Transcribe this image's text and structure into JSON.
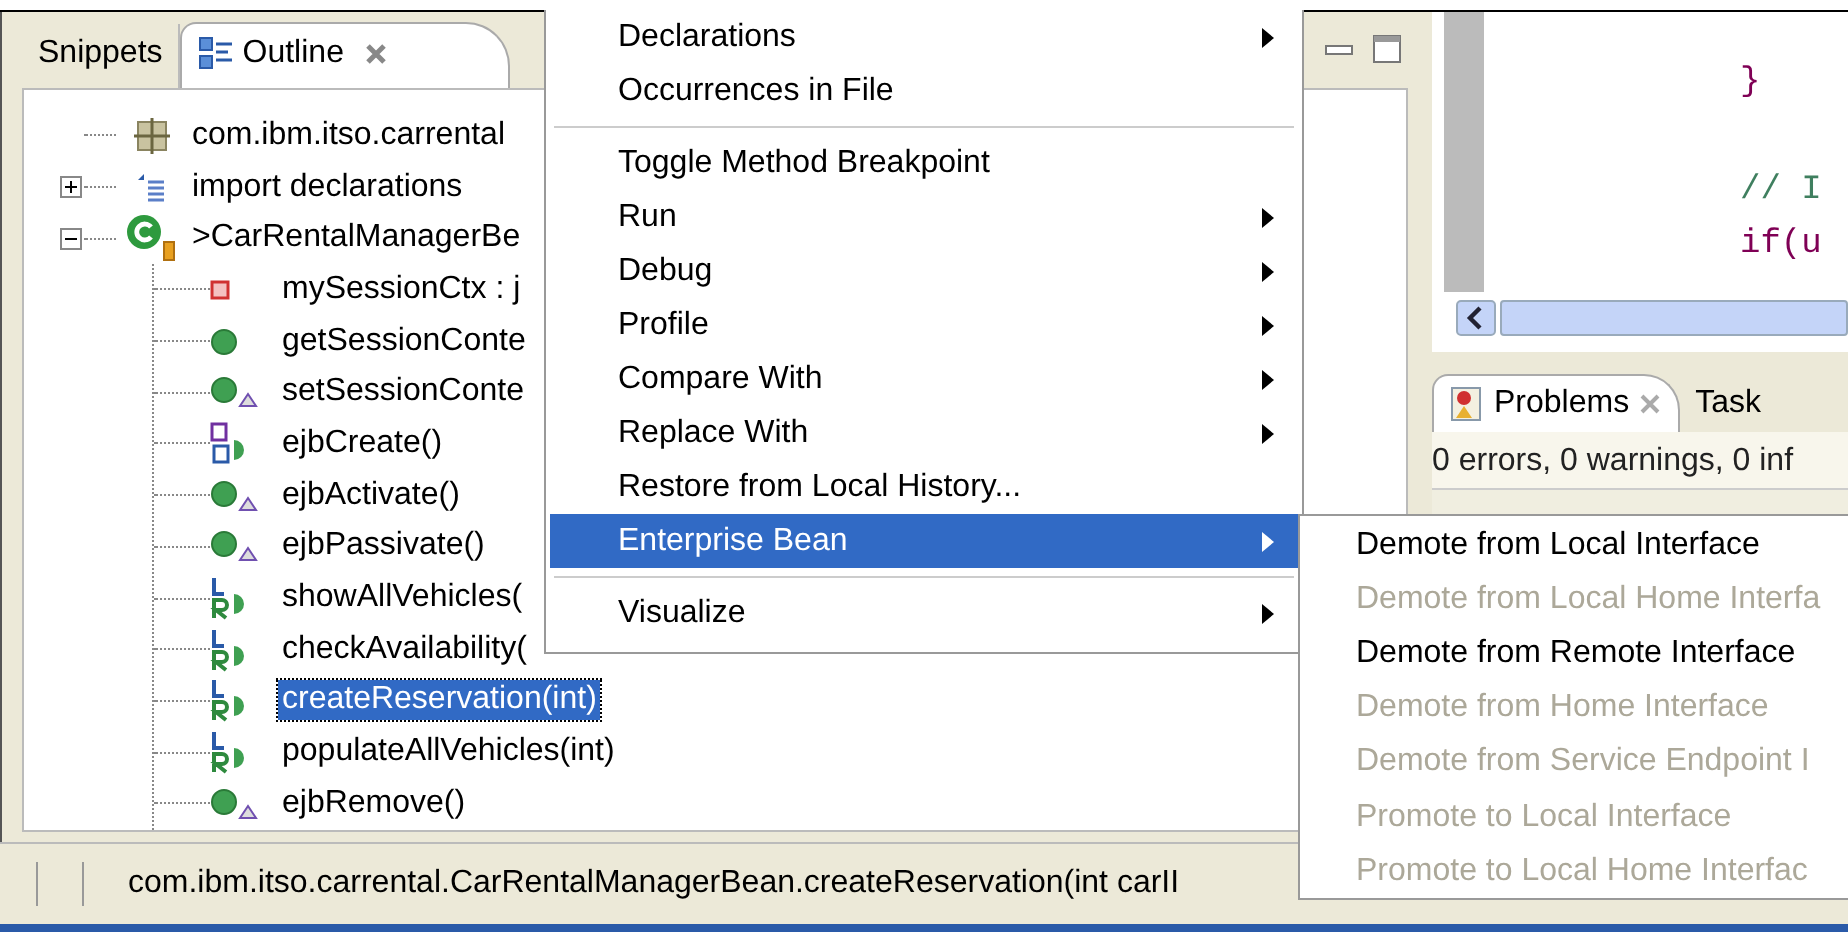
{
  "outline_view": {
    "tabs": [
      {
        "label": "Snippets",
        "selected": false,
        "closable": false
      },
      {
        "label": "Outline",
        "selected": true,
        "closable": true
      }
    ],
    "tree": [
      {
        "label": "com.ibm.itso.carrental",
        "kind": "package",
        "selected": false
      },
      {
        "label": "import declarations",
        "kind": "imports",
        "expanded": false,
        "selected": false
      },
      {
        "label": ">CarRentalManagerBe",
        "kind": "class",
        "expanded": true,
        "selected": false,
        "children": [
          {
            "label": "mySessionCtx : j",
            "kind": "private-field",
            "selected": false
          },
          {
            "label": "getSessionConte",
            "kind": "public-method",
            "selected": false
          },
          {
            "label": "setSessionConte",
            "kind": "overridden-method",
            "selected": false
          },
          {
            "label": "ejbCreate()",
            "kind": "home-method",
            "selected": false
          },
          {
            "label": "ejbActivate()",
            "kind": "overridden-method",
            "selected": false
          },
          {
            "label": "ejbPassivate()",
            "kind": "overridden-method",
            "selected": false
          },
          {
            "label": "showAllVehicles(",
            "kind": "remote-method",
            "selected": false
          },
          {
            "label": "checkAvailability(",
            "kind": "remote-method",
            "selected": false
          },
          {
            "label": "createReservation(int)",
            "kind": "remote-method",
            "selected": true
          },
          {
            "label": "populateAllVehicles(int)",
            "kind": "remote-method",
            "selected": false
          },
          {
            "label": "ejbRemove()",
            "kind": "overridden-method",
            "selected": false
          }
        ]
      }
    ]
  },
  "editor": {
    "code_lines": [
      {
        "text": "}",
        "kind": "code"
      },
      {
        "text": "// I",
        "kind": "comment"
      },
      {
        "text": "if(u",
        "kind": "code"
      }
    ]
  },
  "problems_view": {
    "tabs": [
      {
        "label": "Problems",
        "selected": true
      },
      {
        "label": "Task",
        "selected": false
      }
    ],
    "summary": "0 errors, 0 warnings, 0 inf"
  },
  "context_menu": {
    "items": [
      {
        "kind": "item",
        "label": "Declarations",
        "submenu": true,
        "selected": false
      },
      {
        "kind": "item",
        "label": "Occurrences in File",
        "submenu": false,
        "selected": false
      },
      {
        "kind": "separator"
      },
      {
        "kind": "item",
        "label": "Toggle Method Breakpoint",
        "submenu": false,
        "selected": false
      },
      {
        "kind": "item",
        "label": "Run",
        "submenu": true,
        "selected": false
      },
      {
        "kind": "item",
        "label": "Debug",
        "submenu": true,
        "selected": false
      },
      {
        "kind": "item",
        "label": "Profile",
        "submenu": true,
        "selected": false
      },
      {
        "kind": "item",
        "label": "Compare With",
        "submenu": true,
        "selected": false
      },
      {
        "kind": "item",
        "label": "Replace With",
        "submenu": true,
        "selected": false
      },
      {
        "kind": "item",
        "label": "Restore from Local History...",
        "submenu": false,
        "selected": false
      },
      {
        "kind": "item",
        "label": "Enterprise Bean",
        "submenu": true,
        "selected": true
      },
      {
        "kind": "separator"
      },
      {
        "kind": "item",
        "label": "Visualize",
        "submenu": true,
        "selected": false
      }
    ]
  },
  "submenu": {
    "items": [
      {
        "label": "Demote from Local Interface",
        "disabled": false
      },
      {
        "label": "Demote from Local Home Interfa",
        "disabled": true
      },
      {
        "label": "Demote from Remote Interface",
        "disabled": false
      },
      {
        "label": "Demote from Home Interface",
        "disabled": true
      },
      {
        "label": "Demote from Service Endpoint I",
        "disabled": true
      },
      {
        "label": "Promote to Local Interface",
        "disabled": true
      },
      {
        "label": "Promote to Local Home Interfac",
        "disabled": true
      }
    ]
  },
  "status_bar": {
    "text": "com.ibm.itso.carrental.CarRentalManagerBean.createReservation(int carII"
  }
}
